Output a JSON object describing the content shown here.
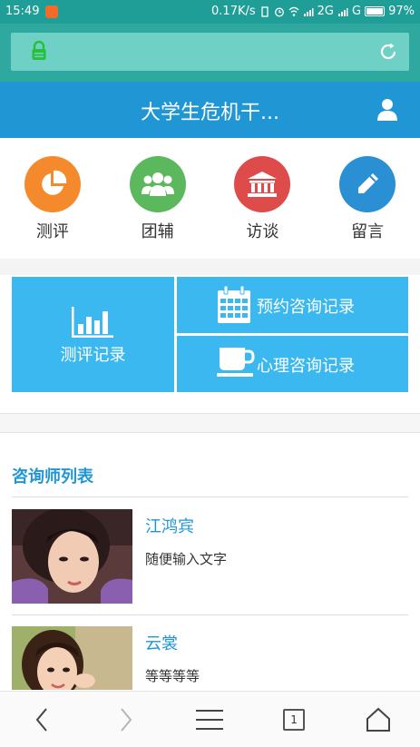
{
  "status_bar": {
    "time": "15:49",
    "net_speed": "0.17K/s",
    "signal1": "2G",
    "signal2": "G",
    "battery": "97%"
  },
  "url_bar": {
    "lock_icon": "lock-icon",
    "refresh_icon": "refresh-icon"
  },
  "header": {
    "title": "大学生危机干...",
    "user_icon": "user-icon"
  },
  "quick_nav": [
    {
      "label": "测评",
      "icon": "pie-chart-icon",
      "color": "#f58a2c"
    },
    {
      "label": "团辅",
      "icon": "group-icon",
      "color": "#5cb85c"
    },
    {
      "label": "访谈",
      "icon": "bank-icon",
      "color": "#dd4b4b"
    },
    {
      "label": "留言",
      "icon": "pencil-icon",
      "color": "#2a8fd3"
    }
  ],
  "tiles": {
    "left": {
      "label": "测评记录",
      "icon": "bar-chart-icon"
    },
    "right_top": {
      "label": "预约咨询记录",
      "icon": "calendar-icon"
    },
    "right_bottom": {
      "label": "心理咨询记录",
      "icon": "coffee-cup-icon"
    },
    "color": "#3ab8ef"
  },
  "consultants": {
    "title": "咨询师列表",
    "items": [
      {
        "name": "江鸿宾",
        "desc": "随便输入文字"
      },
      {
        "name": "云裳",
        "desc": "等等等等"
      }
    ]
  },
  "bottom_nav": {
    "tab_count": "1"
  },
  "colors": {
    "accent": "#2096d4",
    "status_bar": "#1e9e96"
  }
}
